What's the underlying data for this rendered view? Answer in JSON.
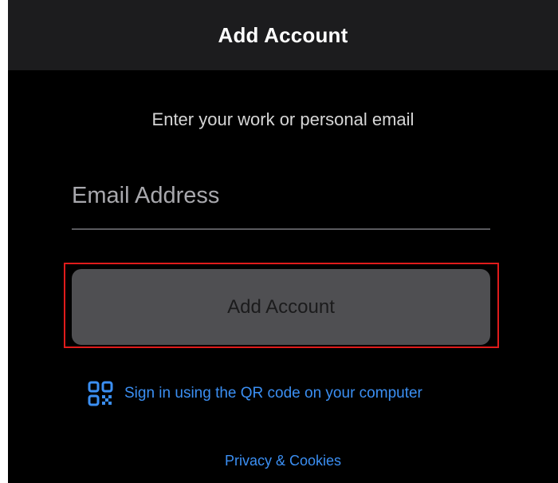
{
  "header": {
    "title": "Add Account"
  },
  "form": {
    "prompt": "Enter your work or personal email",
    "email_placeholder": "Email Address",
    "email_value": "",
    "add_button_label": "Add Account"
  },
  "qr_signin": {
    "icon": "qr-code-icon",
    "label": "Sign in using the QR code on your computer"
  },
  "footer": {
    "privacy_label": "Privacy & Cookies"
  },
  "colors": {
    "background": "#000000",
    "navbar": "#1c1c1e",
    "link_blue": "#3b8ff3",
    "button_disabled": "#4f4f52",
    "highlight_red": "#e01b1b"
  }
}
